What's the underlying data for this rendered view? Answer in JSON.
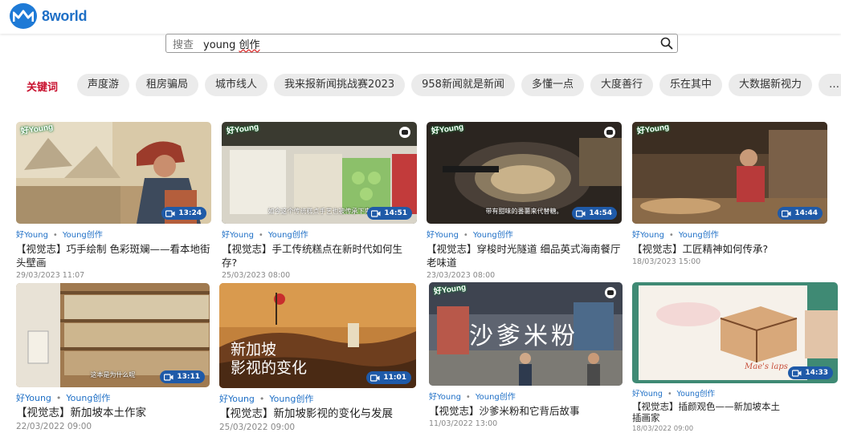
{
  "brand": {
    "name": "8world"
  },
  "search": {
    "label": "搜查",
    "query_prefix": "young ",
    "query_marked": "创作"
  },
  "keywords": {
    "label": "关键词",
    "chips": [
      "声度游",
      "租房骗局",
      "城市线人",
      "我来报新闻挑战赛2023",
      "958新闻就是新闻",
      "多懂一点",
      "大度善行",
      "乐在其中",
      "大数据新视力",
      "…"
    ]
  },
  "tag_primary": "好Young",
  "tag_secondary": "Young创作",
  "tag_dot": "•",
  "cards": [
    {
      "title": "【视觉志】巧手绘制 色彩斑斓——看本地街头壁画",
      "date": "29/03/2023 11:07",
      "duration": "13:24"
    },
    {
      "title": "【视觉志】手工传统糕点在新时代如何生存?",
      "date": "25/03/2023 08:00",
      "duration": "14:51",
      "caption": "如今这个传统糕点手艺也被传承下来"
    },
    {
      "title": "【视觉志】穿梭时光隧道 细品英式海南餐厅老味道",
      "date": "23/03/2023 08:00",
      "duration": "14:54",
      "caption": "带有甜味的番薯来代替糖。"
    },
    {
      "title": "【视觉志】工匠精神如何传承?",
      "date": "18/03/2023 15:00",
      "duration": "14:44"
    },
    {
      "title": "【视觉志】新加坡本土作家",
      "date": "22/03/2022 09:00",
      "duration": "13:11",
      "caption": "这本是为什么呢"
    },
    {
      "title": "【视觉志】新加坡影视的变化与发展",
      "date": "25/03/2022 09:00",
      "duration": "11:01",
      "thumb_text": [
        "新加坡",
        "影视的变化"
      ]
    },
    {
      "title": "【视觉志】沙爹米粉和它背后故事",
      "date": "11/03/2022 13:00",
      "duration": "",
      "thumb_text": [
        "沙爹米粉"
      ]
    },
    {
      "title": "【视觉志】插颜观色——新加坡本土插画家",
      "date": "18/03/2022 09:00",
      "duration": "14:33",
      "thumb_text": [
        "Mae's laps"
      ]
    }
  ],
  "overlay": {
    "badge": "好Young"
  },
  "colors": {
    "brand": "#1e7ad6",
    "keyword_label": "#c8102e",
    "tag": "#1e6fc6",
    "duration_bg": "#1f5aa8"
  }
}
